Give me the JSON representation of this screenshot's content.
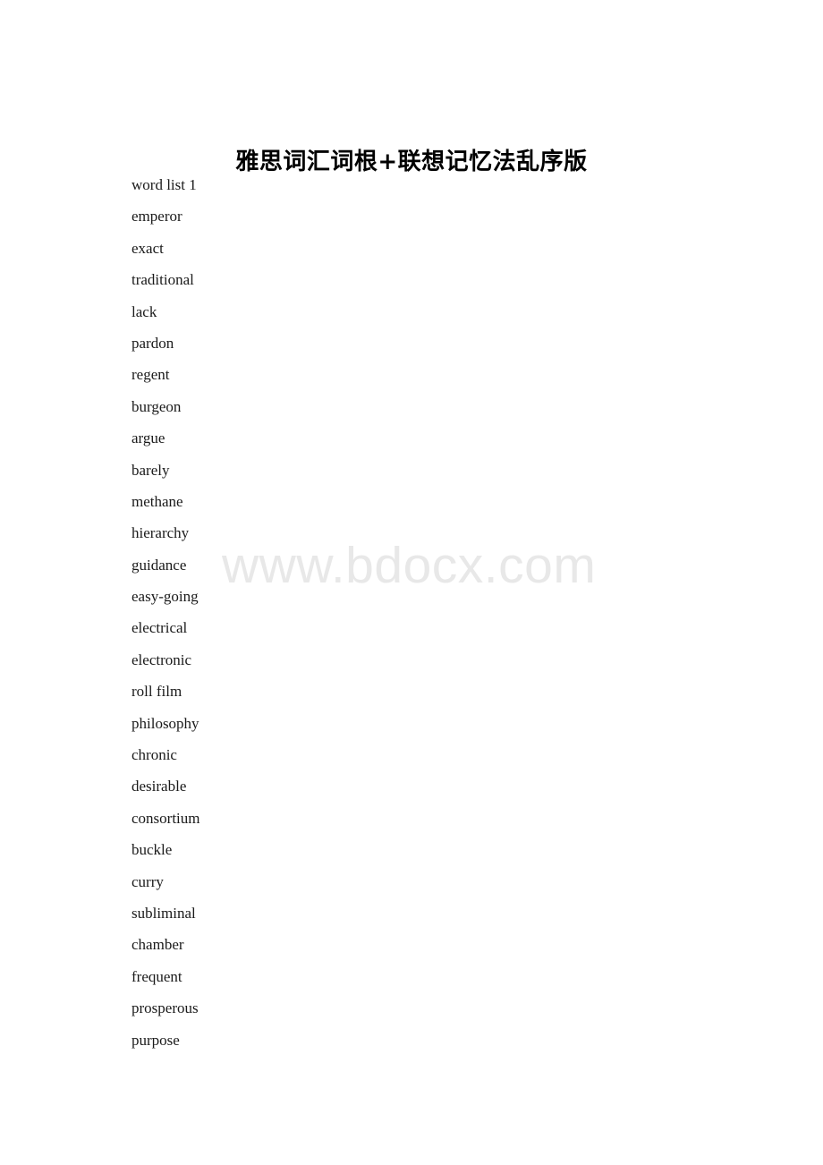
{
  "document": {
    "title": "雅思词汇词根+联想记忆法乱序版",
    "watermark": "www.bdocx.com",
    "watermark_color": "#e8e8e8",
    "text_color": "#1a1a1a",
    "background_color": "#ffffff",
    "words": [
      "word list 1",
      "emperor",
      "exact",
      "traditional",
      "lack",
      "pardon",
      "regent",
      "burgeon",
      "argue",
      "barely",
      "methane",
      "hierarchy",
      "guidance",
      "easy-going",
      "electrical",
      "electronic",
      "roll film",
      "philosophy",
      "chronic",
      "desirable",
      "consortium",
      "buckle",
      "curry",
      "subliminal",
      "chamber",
      "frequent",
      "prosperous",
      "purpose"
    ]
  }
}
